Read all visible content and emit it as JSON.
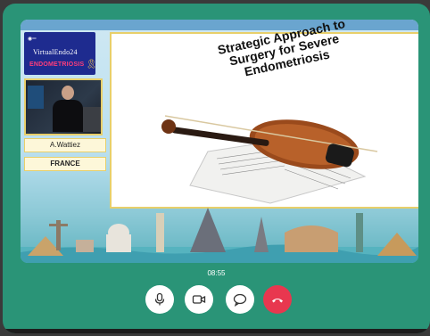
{
  "sidebar": {
    "logo_title": "VirtualEndo24",
    "logo_subtitle": "ENDOMETRIOSIS",
    "speaker_name": "A.Wattiez",
    "speaker_country": "FRANCE"
  },
  "slide": {
    "title": "Strategic Approach to Surgery for Severe Endometriosis"
  },
  "call": {
    "elapsed_time": "08:55"
  },
  "controls": {
    "icons": [
      "microphone-icon",
      "camera-icon",
      "chat-icon",
      "hang-up-icon"
    ]
  },
  "colors": {
    "background": "#2a9477",
    "end_call": "#e8374f",
    "label_border": "#e8cf6a"
  }
}
